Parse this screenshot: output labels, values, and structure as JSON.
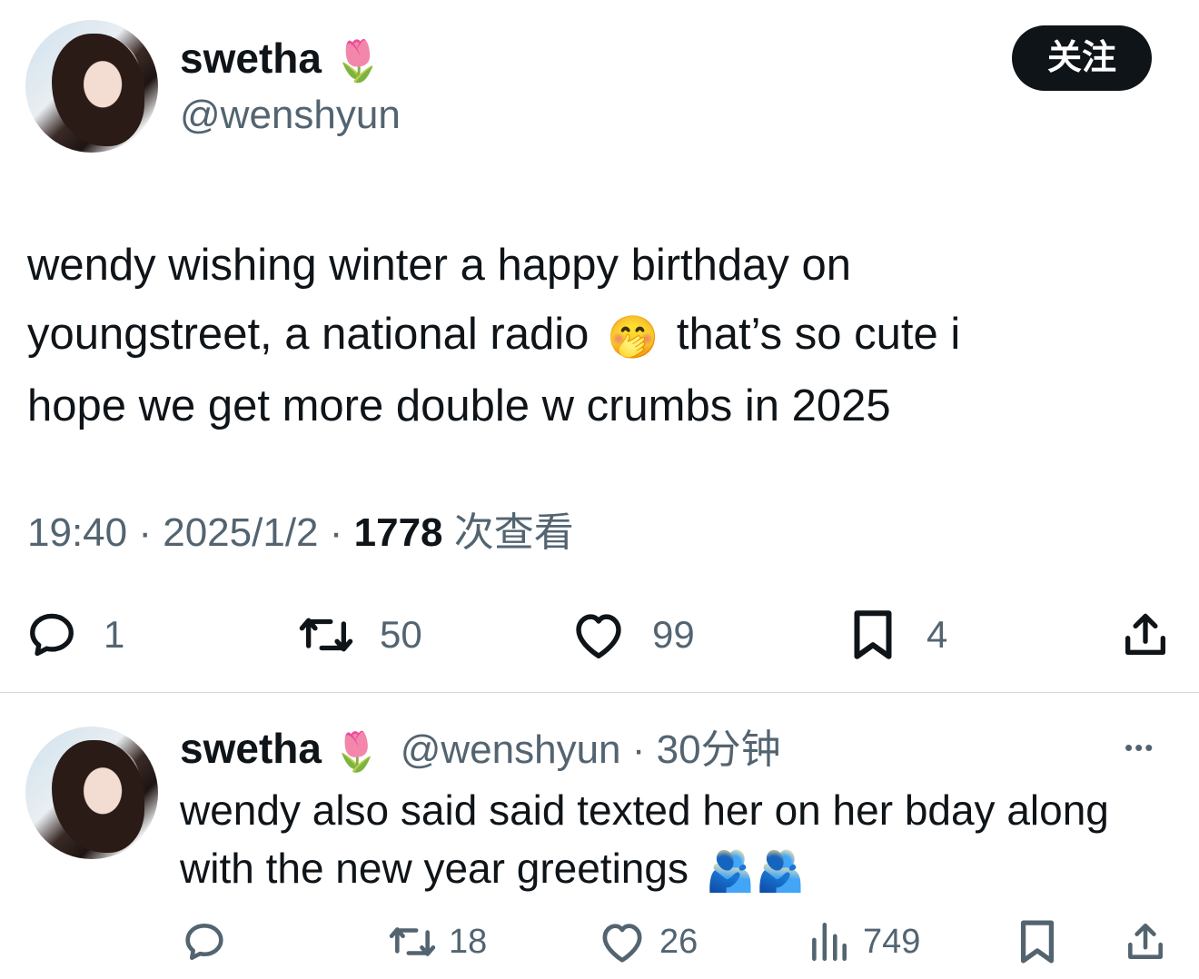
{
  "tweet": {
    "author_name": "swetha",
    "author_emoji": "🌷",
    "author_handle": "@wenshyun",
    "follow_label": "关注",
    "text_line1": "wendy wishing winter a happy birthday on",
    "text_line2a": "youngstreet, a national radio",
    "text_emoji": "🤭",
    "text_line2b": "that’s so cute i",
    "text_line3": "hope we get more double w crumbs in 2025",
    "time": "19:40",
    "date": "2025/1/2",
    "views_count": "1778",
    "views_label": "次查看",
    "separator": "·",
    "actions": {
      "replies": "1",
      "retweets": "50",
      "likes": "99",
      "bookmarks": "4"
    }
  },
  "reply": {
    "author_name": "swetha",
    "author_emoji": "🌷",
    "author_handle": "@wenshyun",
    "separator": "·",
    "time_ago": "30分钟",
    "more_label": "•••",
    "text_line1": "wendy also said said texted her on her bday along",
    "text_line2": "with the new year greetings",
    "text_emoji": "🫂🫂",
    "actions": {
      "replies": "",
      "retweets": "18",
      "likes": "26",
      "views": "749"
    }
  },
  "icons": [
    "reply-icon",
    "retweet-icon",
    "like-icon",
    "bookmark-icon",
    "share-icon",
    "views-icon",
    "more-icon"
  ]
}
